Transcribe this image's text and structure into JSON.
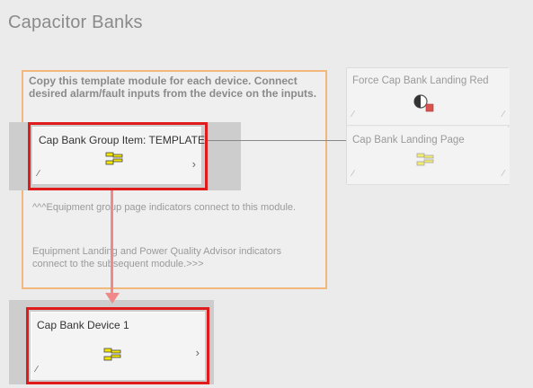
{
  "page": {
    "title": "Capacitor Banks"
  },
  "template": {
    "instructions": "Copy this template module for each device. Connect desired alarm/fault inputs from the device on the inputs.",
    "group_item": {
      "title": "Cap Bank Group Item: TEMPLATE"
    },
    "hint_1": "^^^Equipment group page indicators connect to this module.",
    "hint_2": "Equipment Landing and Power Quality Advisor indicators connect to the subsequent module.>>>"
  },
  "device": {
    "title": "Cap Bank Device 1"
  },
  "right_panel": {
    "force_red": {
      "title": "Force Cap Bank Landing Red"
    },
    "landing_page": {
      "title": "Cap Bank Landing Page"
    }
  },
  "colors": {
    "highlight_frame": "#e01b1b",
    "template_border": "#f2b77a",
    "arrow": "#f08a8a",
    "icon_yellow": "#f2e600"
  },
  "icons": {
    "module_icon": "capacitor-bank-icon",
    "force_red_icon": "half-circle-red-square-icon",
    "corner_icon": "corner-tick-icon",
    "chevron_icon": "chevron-right-icon"
  }
}
